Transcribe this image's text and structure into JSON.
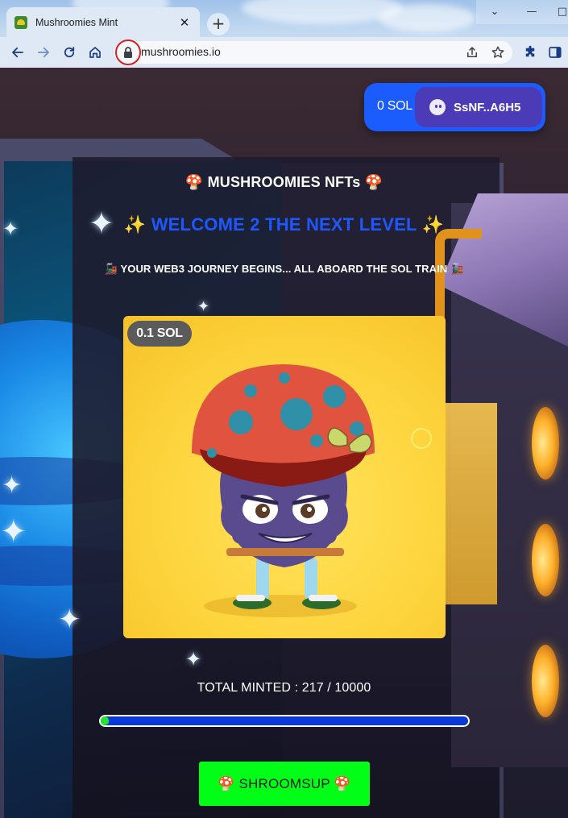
{
  "browser": {
    "tab_title": "Mushroomies Mint",
    "tab_close": "✕",
    "new_tab": "+",
    "url": "mushroomies.io",
    "window_controls": [
      "⌄",
      "—",
      "□"
    ]
  },
  "wallet": {
    "balance": "0 SOL",
    "address": "SsNF..A6H5"
  },
  "hero": {
    "collection_title": "🍄 MUSHROOMIES NFTs 🍄",
    "welcome_emoji": "✨",
    "welcome_text": "WELCOME 2 THE NEXT LEVEL",
    "tagline": "🚂 YOUR WEB3 JOURNEY BEGINS... ALL ABOARD THE SOL TRAIN 🚂"
  },
  "nft": {
    "price": "0.1 SOL",
    "image": "mushroom-character-art"
  },
  "mint": {
    "total_label": "TOTAL MINTED : 217 / 10000",
    "minted": 217,
    "supply": 10000,
    "progress_fraction": 0.0217,
    "button_label": "🍄 SHROOMSUP 🍄"
  },
  "colors": {
    "accent_blue": "#1b5cff",
    "welcome_blue": "#1f57ff",
    "mint_green": "#00ff16",
    "progress_green": "#24e52a",
    "wallet_purple": "#4b3bb7",
    "nft_yellow": "#fdd43c"
  },
  "icons": [
    "back-arrow-icon",
    "forward-arrow-icon",
    "reload-icon",
    "home-icon",
    "lock-icon",
    "share-icon",
    "bookmark-star-icon",
    "extensions-puzzle-icon",
    "sidebar-icon"
  ]
}
